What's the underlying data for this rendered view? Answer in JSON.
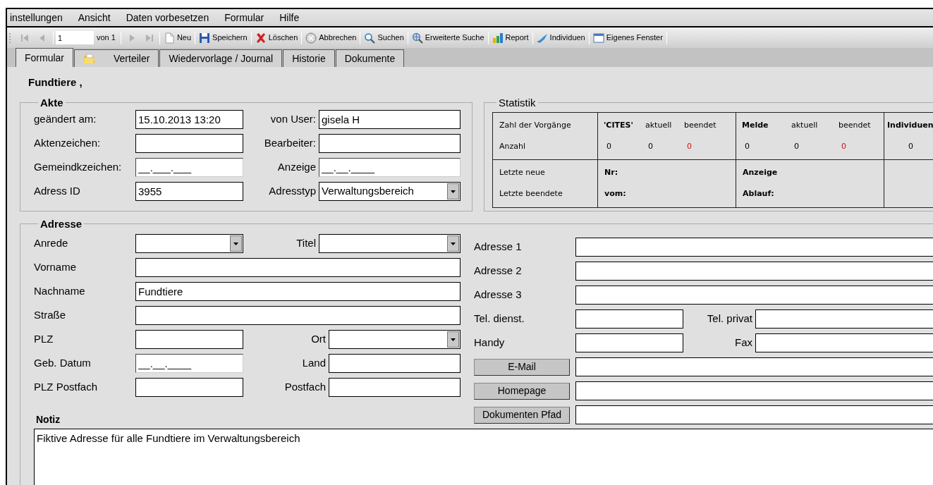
{
  "menu": [
    "instellungen",
    "Ansicht",
    "Daten vorbesetzen",
    "Formular",
    "Hilfe"
  ],
  "toolbar": {
    "nav_back": [
      {
        "kind": "first",
        "disabled": true
      },
      {
        "kind": "prev",
        "disabled": true
      }
    ],
    "record": "1",
    "record_count": "von 1",
    "nav_forward": [
      {
        "kind": "next",
        "disabled": true
      },
      {
        "kind": "last",
        "disabled": true
      }
    ],
    "buttons": [
      {
        "kind": "new",
        "label": "Neu"
      },
      {
        "kind": "save",
        "label": "Speichern"
      },
      {
        "kind": "delete",
        "label": "Löschen"
      },
      {
        "kind": "cancel",
        "label": "Abbrechen"
      },
      {
        "kind": "search",
        "label": "Suchen"
      },
      {
        "kind": "advanced-search",
        "label": "Erweiterte Suche"
      },
      {
        "kind": "report",
        "label": "Report"
      },
      {
        "kind": "individuals",
        "label": "Individuen"
      },
      {
        "kind": "window",
        "label": "Eigenes Fenster"
      }
    ]
  },
  "tabs": [
    {
      "label": "Formular",
      "selected": true,
      "kind": "text"
    },
    {
      "label": "Verteiler",
      "selected": false,
      "kind": "icon"
    },
    {
      "label": "Wiedervorlage / Journal",
      "selected": false,
      "kind": "text"
    },
    {
      "label": "Historie",
      "selected": false,
      "kind": "text"
    },
    {
      "label": "Dokumente",
      "selected": false,
      "kind": "text"
    }
  ],
  "header": "Fundtiere ,",
  "akte": {
    "legend": "Akte",
    "rows": [
      {
        "left": {
          "label": "geändert am:",
          "kind": "text",
          "value": "15.10.2013 13:20"
        },
        "right": {
          "label": "von User:",
          "kind": "text",
          "value": "gisela H"
        }
      },
      {
        "left": {
          "label": "Aktenzeichen:",
          "kind": "text"
        },
        "right": {
          "label": "Bearbeiter:",
          "kind": "text"
        }
      },
      {
        "left": {
          "label": "Gemeindkzeichen:",
          "kind": "masked",
          "value": "__.___.___"
        },
        "right": {
          "label": "Anzeige",
          "kind": "masked",
          "value": "__.__.____"
        }
      },
      {
        "left": {
          "label": "Adress ID",
          "kind": "text",
          "value": "3955"
        },
        "right": {
          "label": "Adresstyp",
          "kind": "select",
          "value": "Verwaltungsbereich"
        }
      }
    ]
  },
  "statistik": {
    "legend": "Statistik",
    "counts": {
      "row_labels": [
        "Zahl der Vorgänge",
        "Anzahl"
      ],
      "groups": [
        {
          "title": "'CITES'",
          "headings": [
            "aktuell",
            "beendet"
          ],
          "values": [
            {
              "text": "0",
              "highlighted": false
            },
            {
              "text": "0",
              "highlighted": false
            },
            {
              "text": "0",
              "highlighted": true
            }
          ]
        },
        {
          "title": "Melde",
          "headings": [
            "aktuell",
            "beendet"
          ],
          "values": [
            {
              "text": "0",
              "highlighted": false
            },
            {
              "text": "0",
              "highlighted": false
            },
            {
              "text": "0",
              "highlighted": true
            }
          ]
        },
        {
          "title": "Individuen",
          "values": [
            {
              "text": "0",
              "highlighted": false
            }
          ]
        }
      ]
    },
    "last": {
      "row_labels": [
        "Letzte neue",
        "Letzte beendete"
      ],
      "groups": [
        [
          "Nr:",
          "vom:"
        ],
        [
          "Anzeige",
          "Ablauf:"
        ]
      ]
    }
  },
  "adresse": {
    "legend": "Adresse",
    "left_rows": [
      {
        "left": {
          "label": "Anrede",
          "kind": "select"
        },
        "right": {
          "label": "Titel",
          "kind": "select"
        }
      },
      {
        "left": {
          "label": "Vorname",
          "kind": "text"
        }
      },
      {
        "left": {
          "label": "Nachname",
          "kind": "text",
          "value": "Fundtiere"
        }
      },
      {
        "left": {
          "label": "Straße",
          "kind": "text"
        }
      },
      {
        "left": {
          "label": "PLZ",
          "kind": "text"
        },
        "right": {
          "label": "Ort",
          "kind": "select"
        }
      },
      {
        "left": {
          "label": "Geb. Datum",
          "kind": "masked",
          "value": "__.__.____"
        },
        "right": {
          "label": "Land",
          "kind": "text"
        }
      },
      {
        "left": {
          "label": "PLZ Postfach",
          "kind": "text"
        },
        "right": {
          "label": "Postfach",
          "kind": "text"
        }
      }
    ],
    "right_rows": [
      {
        "kind": "label",
        "left": {
          "label": "Adresse 1",
          "kind": "text"
        }
      },
      {
        "kind": "label",
        "left": {
          "label": "Adresse 2",
          "kind": "text"
        }
      },
      {
        "kind": "label",
        "left": {
          "label": "Adresse 3",
          "kind": "text"
        }
      },
      {
        "kind": "label",
        "left": {
          "label": "Tel. dienst.",
          "kind": "text"
        },
        "right": {
          "label": "Tel. privat",
          "kind": "text"
        }
      },
      {
        "kind": "label",
        "left": {
          "label": "Handy",
          "kind": "text"
        },
        "right": {
          "label": "Fax",
          "kind": "text"
        }
      },
      {
        "kind": "button",
        "left": {
          "label": "E-Mail",
          "kind": "text"
        }
      },
      {
        "kind": "button",
        "left": {
          "label": "Homepage",
          "kind": "text"
        }
      },
      {
        "kind": "button",
        "left": {
          "label": "Dokumenten Pfad",
          "kind": "text"
        }
      }
    ],
    "notiz": {
      "label": "Notiz",
      "value": "Fiktive Adresse für alle Fundtiere im Verwaltungsbereich"
    }
  }
}
